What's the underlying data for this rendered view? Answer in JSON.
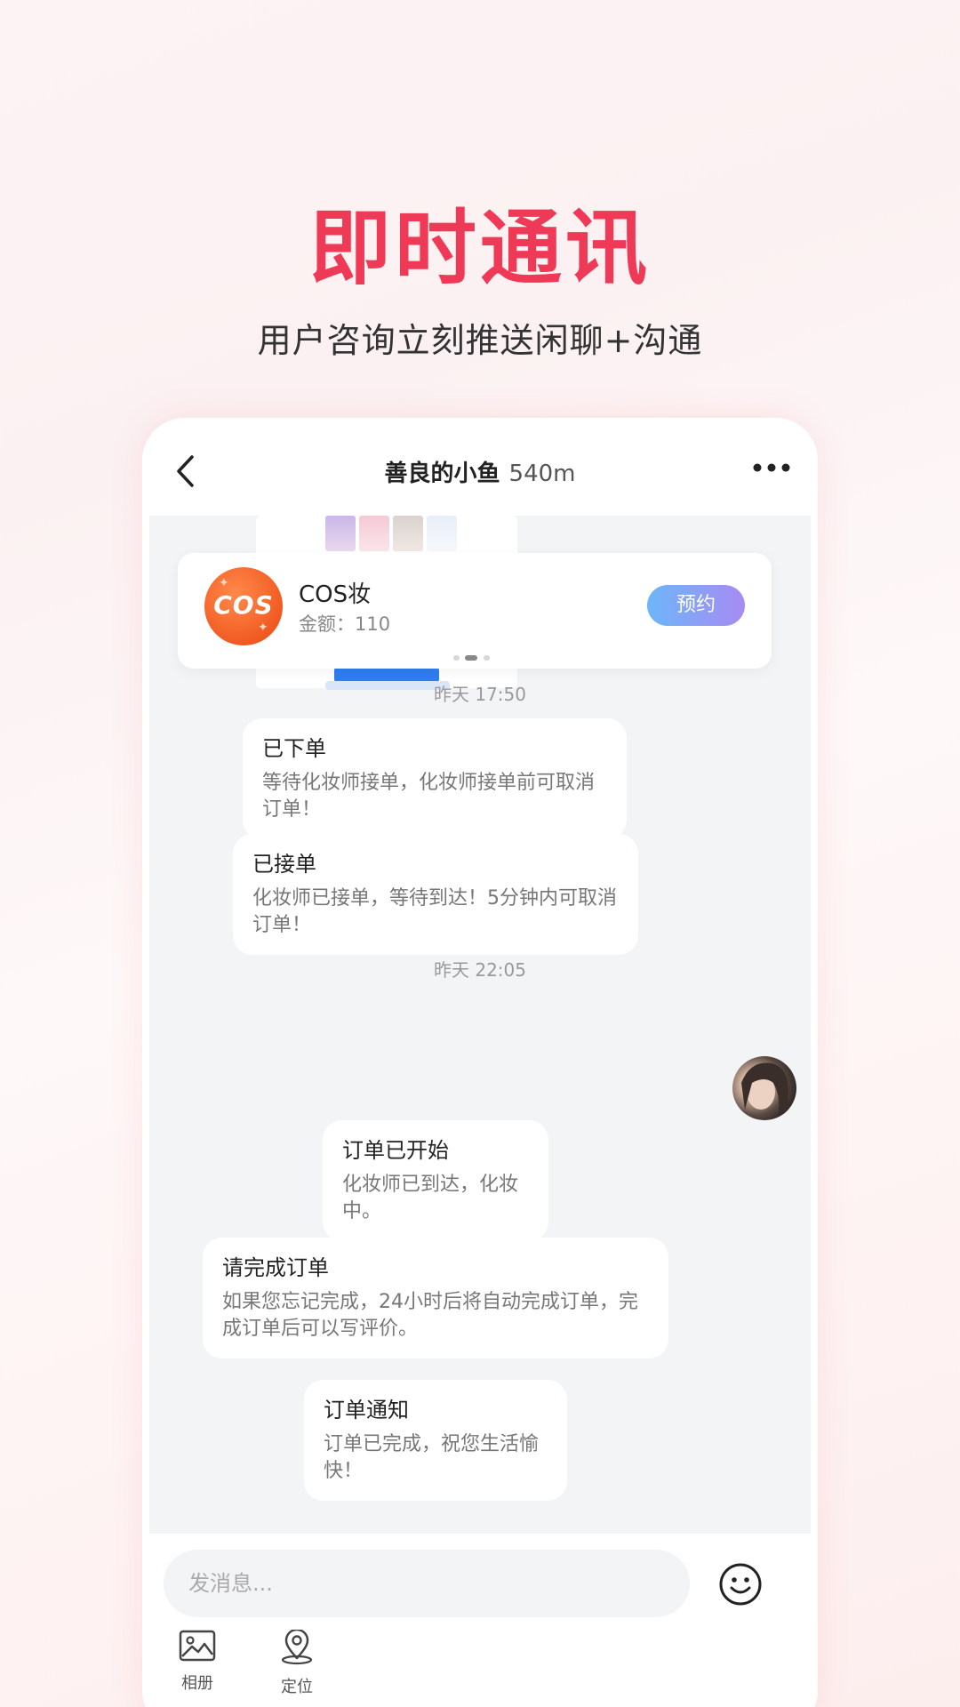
{
  "hero": {
    "title": "即时通讯",
    "subtitle": "用户咨询立刻推送闲聊+沟通"
  },
  "header": {
    "name": "善良的小鱼",
    "distance": "540m",
    "back_icon": "chevron-left-icon",
    "more_icon": "more-dots-icon"
  },
  "product_card": {
    "logo_text": "COS",
    "name": "COS妆",
    "price": "金额：110",
    "book_label": "预约",
    "carousel_index": 2,
    "carousel_count": 3
  },
  "messages": {
    "time1": "昨天 17:50",
    "m1": {
      "title": "已下单",
      "text": "等待化妆师接单，化妆师接单前可取消订单！"
    },
    "m2": {
      "title": "已接单",
      "text": "化妆师已接单，等待到达！5分钟内可取消订单！"
    },
    "time2": "昨天 22:05",
    "m3": {
      "title": "订单已开始",
      "text": "化妆师已到达，化妆中。"
    },
    "m4": {
      "title": "请完成订单",
      "text": "如果您忘记完成，24小时后将自动完成订单，完成订单后可以写评价。"
    },
    "m5": {
      "title": "订单通知",
      "text": "订单已完成，祝您生活愉快！"
    }
  },
  "input": {
    "placeholder": "发消息...",
    "emoji_icon": "smiley-icon"
  },
  "tools": {
    "album": {
      "label": "相册",
      "icon": "image-icon"
    },
    "location": {
      "label": "定位",
      "icon": "location-pin-icon"
    }
  },
  "colors": {
    "accent": "#ef3a57",
    "button_gradient_start": "#6db6f8",
    "button_gradient_end": "#a78bf3",
    "chat_background": "#f3f4f6"
  }
}
